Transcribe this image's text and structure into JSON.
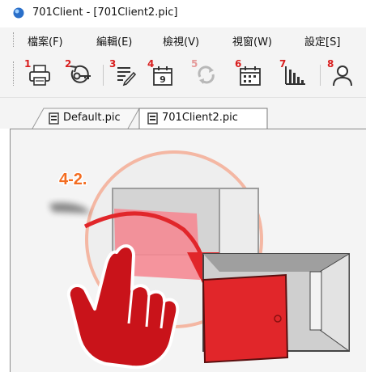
{
  "window": {
    "title": "701Client - [701Client2.pic]"
  },
  "menu": {
    "items": [
      "檔案(F)",
      "編輯(E)",
      "檢視(V)",
      "視窗(W)",
      "設定[S]"
    ]
  },
  "toolbar": {
    "buttons": [
      {
        "number": "1",
        "icon": "printer-icon",
        "enabled": true
      },
      {
        "number": "2",
        "icon": "key-icon",
        "enabled": true
      },
      {
        "number": "3",
        "icon": "checklist-icon",
        "enabled": true
      },
      {
        "number": "4",
        "icon": "calendar-icon",
        "day": "9",
        "enabled": true
      },
      {
        "number": "5",
        "icon": "refresh-icon",
        "enabled": false
      },
      {
        "number": "6",
        "icon": "calendar-grid-icon",
        "enabled": true
      },
      {
        "number": "7",
        "icon": "bar-chart-icon",
        "enabled": true
      },
      {
        "number": "8",
        "icon": "user-icon",
        "enabled": true
      }
    ]
  },
  "tabs": [
    {
      "label": "Default.pic",
      "active": false
    },
    {
      "label": "701Client2.pic",
      "active": true
    }
  ],
  "tutorial": {
    "step_label": "4-2."
  },
  "colors": {
    "accent_red": "#e1262a",
    "pink": "#f58a93",
    "step_orange": "#f36d21"
  }
}
